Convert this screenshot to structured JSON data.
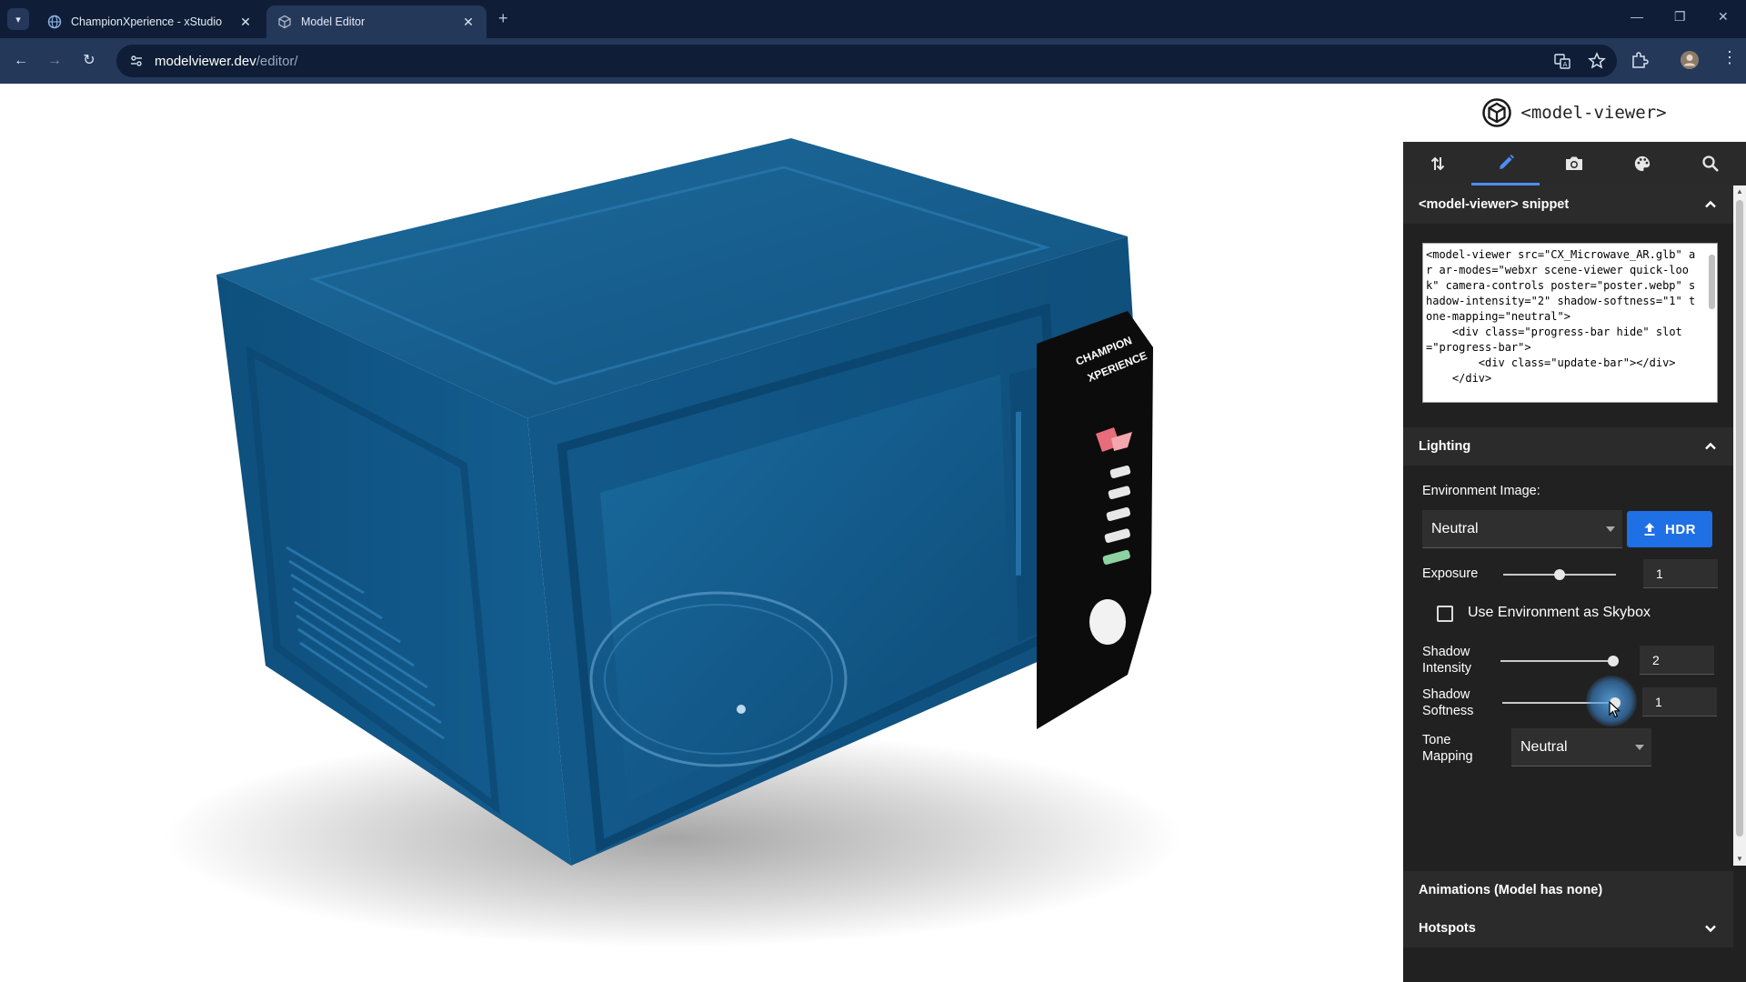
{
  "browser": {
    "tabs": [
      {
        "title": "ChampionXperience - xStudio",
        "active": false
      },
      {
        "title": "Model Editor",
        "active": true
      }
    ],
    "url_host": "modelviewer.dev",
    "url_path": "/editor/"
  },
  "panel": {
    "app_name": "<model-viewer>",
    "snippet": {
      "title": "<model-viewer> snippet",
      "code": "<model-viewer src=\"CX_Microwave_AR.glb\" ar ar-modes=\"webxr scene-viewer quick-look\" camera-controls poster=\"poster.webp\" shadow-intensity=\"2\" shadow-softness=\"1\" tone-mapping=\"neutral\">\n    <div class=\"progress-bar hide\" slot=\"progress-bar\">\n        <div class=\"update-bar\"></div>\n    </div>"
    },
    "lighting": {
      "title": "Lighting",
      "environment_label": "Environment Image:",
      "environment_value": "Neutral",
      "hdr_label": "HDR",
      "exposure_label": "Exposure",
      "exposure_value": "1",
      "exposure_fraction": 0.5,
      "skybox_label": "Use Environment as Skybox",
      "skybox_checked": false,
      "shadow_intensity_label_1": "Shadow",
      "shadow_intensity_label_2": "Intensity",
      "shadow_intensity_value": "2",
      "shadow_intensity_fraction": 1.0,
      "shadow_softness_label_1": "Shadow",
      "shadow_softness_label_2": "Softness",
      "shadow_softness_value": "1",
      "shadow_softness_fraction": 1.0,
      "tone_mapping_label_1": "Tone",
      "tone_mapping_label_2": "Mapping",
      "tone_mapping_value": "Neutral"
    },
    "animations_title": "Animations (Model has none)",
    "hotspots_title": "Hotspots"
  },
  "model": {
    "brand_line_1": "CHAMPION",
    "brand_line_2": "XPERIENCE",
    "body_color": "#155f8f"
  },
  "colors": {
    "accent": "#4c8df6",
    "panel_bg": "#212121",
    "chrome_dark": "#0f1e36",
    "chrome_mid": "#24385a"
  }
}
